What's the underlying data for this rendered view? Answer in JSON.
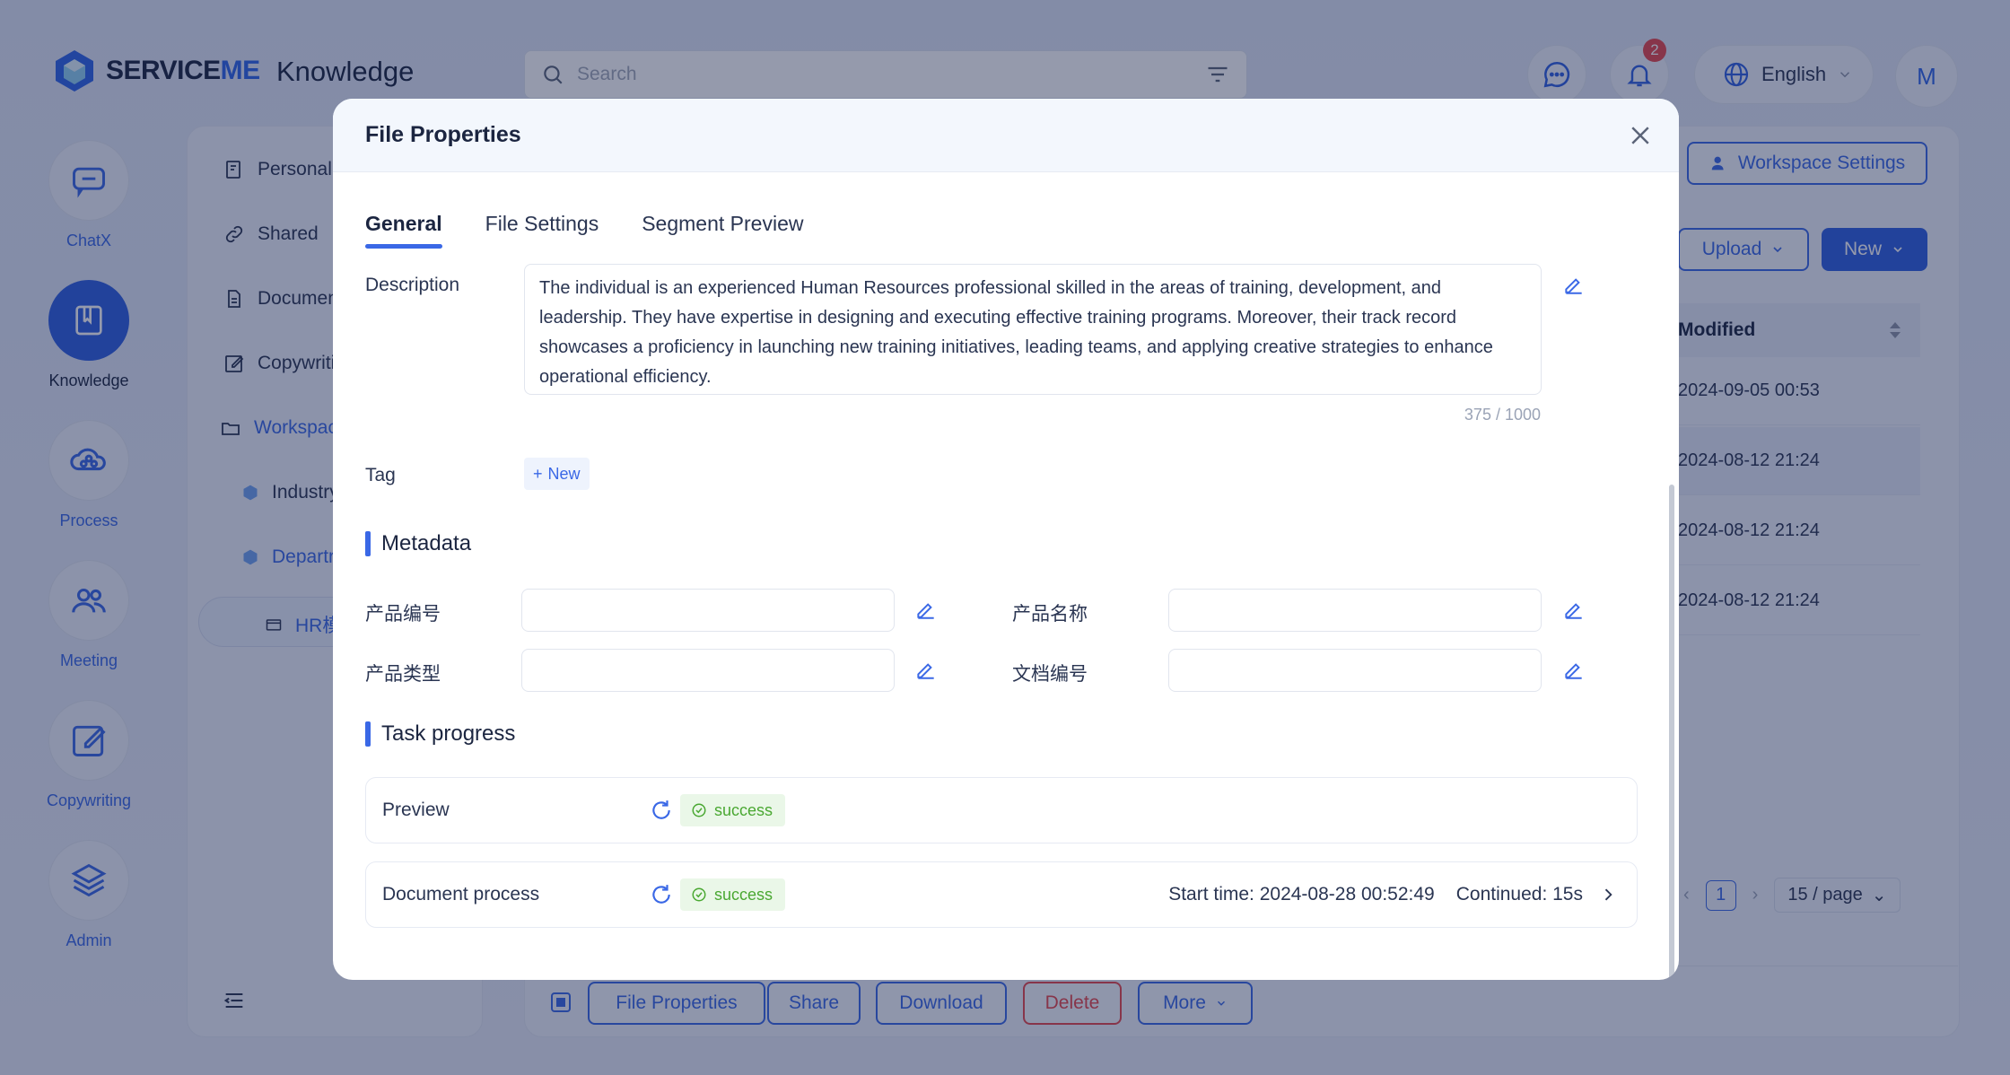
{
  "app": {
    "brand_a": "SERVICE",
    "brand_b": "ME",
    "title": "Knowledge"
  },
  "search": {
    "placeholder": "Search"
  },
  "notifications": {
    "count": "2"
  },
  "language": {
    "label": "English"
  },
  "user": {
    "initial": "M"
  },
  "rail": [
    {
      "label": "ChatX",
      "icon": "chat-icon"
    },
    {
      "label": "Knowledge",
      "icon": "book-icon",
      "active": true
    },
    {
      "label": "Process",
      "icon": "cloud-network-icon"
    },
    {
      "label": "Meeting",
      "icon": "people-icon"
    },
    {
      "label": "Copywriting",
      "icon": "edit-square-icon"
    },
    {
      "label": "Admin",
      "icon": "layers-icon"
    }
  ],
  "sidebar": {
    "items": [
      {
        "label": "Personal S",
        "icon": "doc-search-icon"
      },
      {
        "label": "Shared",
        "icon": "link-icon"
      },
      {
        "label": "Documen",
        "icon": "document-icon"
      },
      {
        "label": "Copywritin",
        "icon": "edit-icon"
      },
      {
        "label": "Workspace",
        "icon": "folder-open-icon"
      },
      {
        "label": "Industry",
        "icon": "cube-icon"
      },
      {
        "label": "Departr",
        "icon": "cube-icon"
      },
      {
        "label": "HR模",
        "icon": "folder-icon"
      }
    ]
  },
  "main": {
    "workspace_settings": "Workspace Settings",
    "upload": "Upload",
    "new": "New",
    "column_modified": "Modified",
    "rows": [
      "2024-09-05 00:53",
      "2024-08-12 21:24",
      "2024-08-12 21:24",
      "2024-08-12 21:24"
    ],
    "pager": {
      "current": "1",
      "page_size": "15 / page"
    },
    "actions": {
      "file_properties": "File Properties",
      "share": "Share",
      "download": "Download",
      "delete": "Delete",
      "more": "More"
    }
  },
  "modal": {
    "title": "File Properties",
    "tabs": [
      "General",
      "File Settings",
      "Segment Preview"
    ],
    "description_label": "Description",
    "description_value": "The individual is an experienced Human Resources professional skilled in the areas of training, development, and leadership. They have expertise in designing and executing effective training programs. Moreover, their track record showcases a proficiency in launching new training initiatives, leading teams, and applying creative strategies to enhance operational efficiency.",
    "description_counter": "375 / 1000",
    "tag_label": "Tag",
    "tag_new": "New",
    "metadata_heading": "Metadata",
    "metadata": [
      {
        "label": "产品编号",
        "value": ""
      },
      {
        "label": "产品名称",
        "value": ""
      },
      {
        "label": "产品类型",
        "value": ""
      },
      {
        "label": "文档编号",
        "value": ""
      }
    ],
    "task_heading": "Task progress",
    "tasks": [
      {
        "name": "Preview",
        "status": "success"
      },
      {
        "name": "Document process",
        "status": "success",
        "start_time": "Start time: 2024-08-28 00:52:49",
        "continued": "Continued: 15s"
      }
    ]
  },
  "colors": {
    "accent": "#3a68e6",
    "success": "#4aa832",
    "danger": "#e5484d"
  }
}
